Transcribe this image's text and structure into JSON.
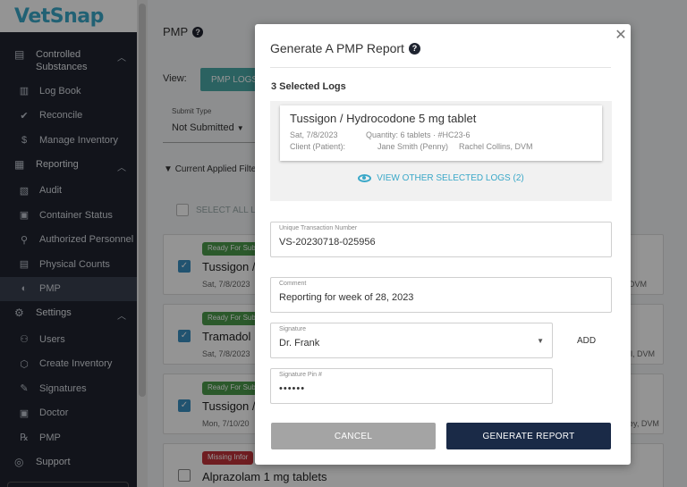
{
  "app": {
    "logo": "VetSnap"
  },
  "sidebar": {
    "sections": [
      {
        "label": "Controlled Substances",
        "icon": "document-icon",
        "items": [
          {
            "label": "Log Book",
            "icon": "book-icon"
          },
          {
            "label": "Reconcile",
            "icon": "check-icon"
          },
          {
            "label": "Manage Inventory",
            "icon": "dollar-icon"
          }
        ]
      },
      {
        "label": "Reporting",
        "icon": "chart-icon",
        "items": [
          {
            "label": "Audit",
            "icon": "audit-icon"
          },
          {
            "label": "Container Status",
            "icon": "container-icon"
          },
          {
            "label": "Authorized Personnel",
            "icon": "person-icon"
          },
          {
            "label": "Physical Counts",
            "icon": "clipboard-icon"
          },
          {
            "label": "PMP",
            "icon": "pill-icon"
          }
        ]
      },
      {
        "label": "Settings",
        "icon": "gear-icon",
        "items": [
          {
            "label": "Users",
            "icon": "user-icon"
          },
          {
            "label": "Create Inventory",
            "icon": "box-icon"
          },
          {
            "label": "Signatures",
            "icon": "pen-icon"
          },
          {
            "label": "Doctor",
            "icon": "doctor-icon"
          },
          {
            "label": "PMP",
            "icon": "rx-icon"
          }
        ]
      },
      {
        "label": "Support",
        "icon": "globe-icon",
        "items": []
      }
    ]
  },
  "main": {
    "title": "PMP",
    "view_label": "View:",
    "view_button": "PMP LOGS",
    "submit_type": {
      "caption": "Submit Type",
      "value": "Not Submitted"
    },
    "filters_label": "Current Applied Filte",
    "select_all": "SELECT ALL LO",
    "cards": [
      {
        "badge": "Ready For Sub",
        "name": "Tussigon /",
        "meta": "Sat, 7/8/2023",
        "right": "DVM",
        "checked": true
      },
      {
        "badge": "Ready For Sub",
        "name": "Tramadol",
        "meta": "Sat, 7/8/2023",
        "right": "ll, DVM",
        "checked": true
      },
      {
        "badge": "Ready For Sub",
        "name": "Tussigon /",
        "meta": "Mon, 7/10/20",
        "right": "ey, DVM",
        "checked": true
      },
      {
        "badge": "Missing Infor",
        "name": "Alprazolam 1 mg tablets",
        "meta": "",
        "right": "",
        "checked": false
      }
    ]
  },
  "modal": {
    "title": "Generate A PMP Report",
    "selected_title": "3 Selected Logs",
    "log": {
      "name": "Tussigon / Hydrocodone 5 mg tablet",
      "date": "Sat, 7/8/2023",
      "quantity": "Quantity: 6 tablets · #HC23-6",
      "client_label": "Client (Patient):",
      "client": "Jane Smith (Penny)",
      "doctor": "Rachel Collins, DVM"
    },
    "view_other": "VIEW OTHER SELECTED LOGS (2)",
    "utn": {
      "caption": "Unique Transaction Number",
      "value": "VS-20230718-025956"
    },
    "comment": {
      "caption": "Comment",
      "value": "Reporting for week of 28, 2023"
    },
    "signature": {
      "caption": "Signature",
      "value": "Dr. Frank"
    },
    "add": "ADD",
    "pin": {
      "caption": "Signature Pin #",
      "value": "••••••"
    },
    "cancel": "CANCEL",
    "generate": "GENERATE REPORT"
  }
}
